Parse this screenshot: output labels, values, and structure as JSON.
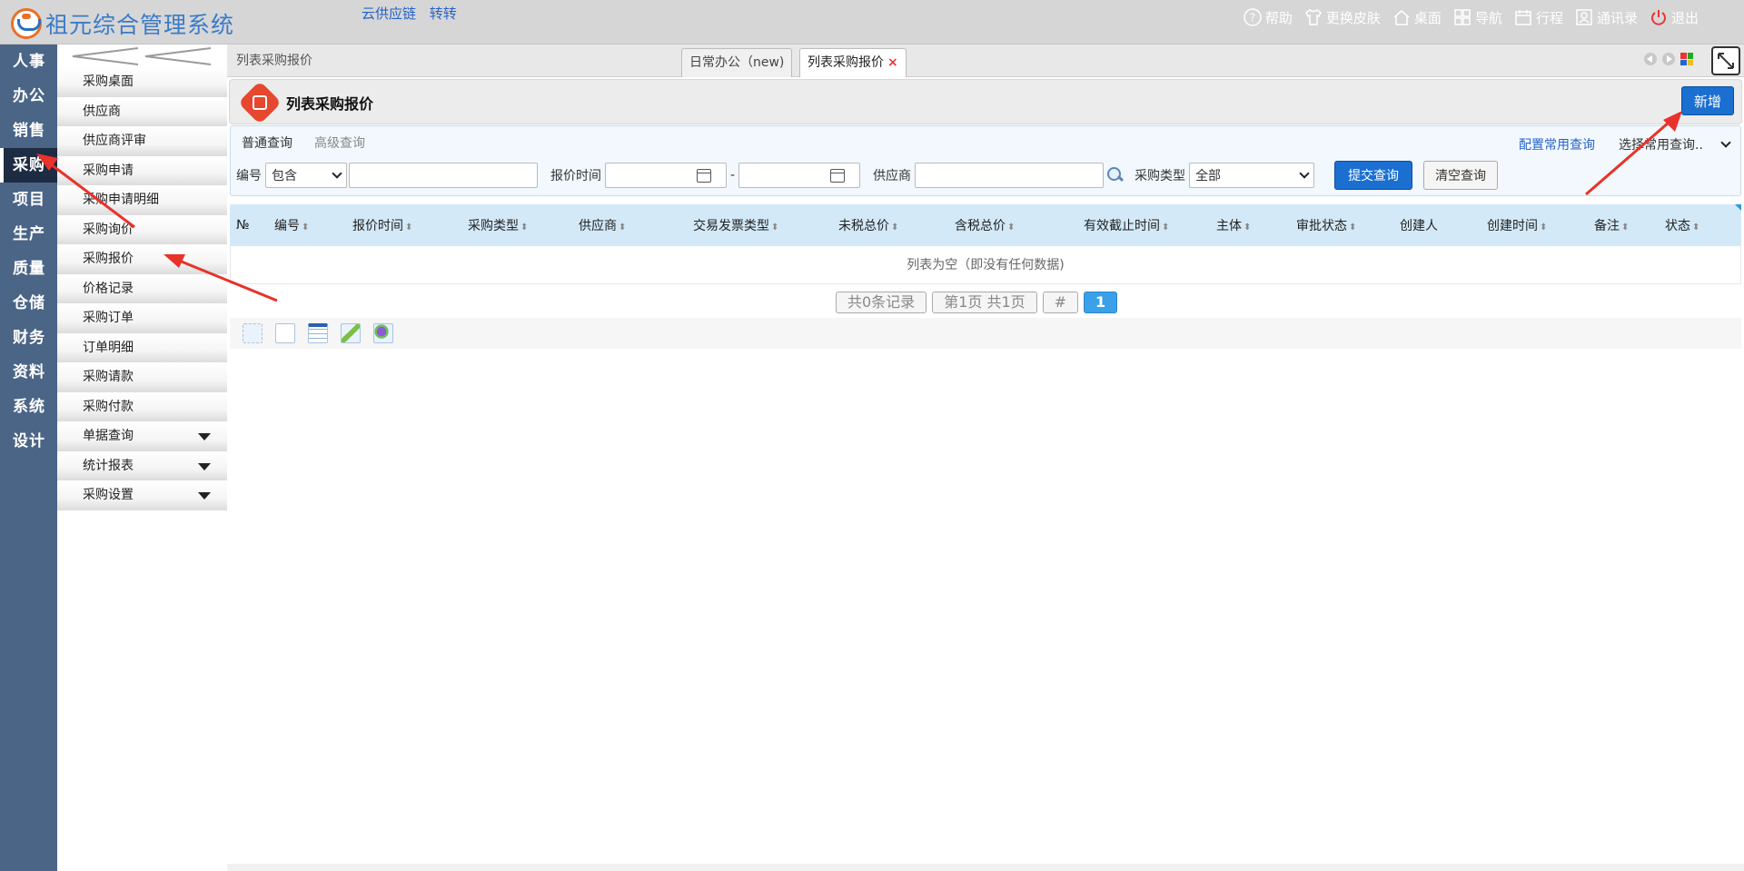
{
  "app": {
    "title": "祖元综合管理系统",
    "links": [
      "云供应链",
      "转转"
    ]
  },
  "top_tools": [
    {
      "label": "帮助",
      "icon": "help-icon"
    },
    {
      "label": "更换皮肤",
      "icon": "shirt-icon"
    },
    {
      "label": "桌面",
      "icon": "home-icon"
    },
    {
      "label": "导航",
      "icon": "nav-grid-icon"
    },
    {
      "label": "行程",
      "icon": "calendar-icon"
    },
    {
      "label": "通讯录",
      "icon": "contacts-icon"
    },
    {
      "label": "退出",
      "icon": "power-icon"
    }
  ],
  "modules": [
    "人事",
    "办公",
    "销售",
    "采购",
    "项目",
    "生产",
    "质量",
    "仓储",
    "财务",
    "资料",
    "系统",
    "设计"
  ],
  "active_module": "采购",
  "submenu": [
    {
      "label": "采购桌面"
    },
    {
      "label": "供应商"
    },
    {
      "label": "供应商评审"
    },
    {
      "label": "采购申请"
    },
    {
      "label": "采购申请明细"
    },
    {
      "label": "采购询价"
    },
    {
      "label": "采购报价"
    },
    {
      "label": "价格记录"
    },
    {
      "label": "采购订单"
    },
    {
      "label": "订单明细"
    },
    {
      "label": "采购请款"
    },
    {
      "label": "采购付款"
    },
    {
      "label": "单据查询",
      "expandable": true
    },
    {
      "label": "统计报表",
      "expandable": true
    },
    {
      "label": "采购设置",
      "expandable": true
    }
  ],
  "breadcrumb": "列表采购报价",
  "tabs": [
    {
      "label": "日常办公（new)",
      "active": false
    },
    {
      "label": "列表采购报价",
      "active": true,
      "close": "×"
    }
  ],
  "page": {
    "title": "列表采购报价",
    "add_button": "新增"
  },
  "query": {
    "tab_basic": "普通查询",
    "tab_advanced": "高级查询",
    "config_link": "配置常用查询",
    "common_query_placeholder": "选择常用查询..",
    "code_label": "编号",
    "code_op": "包含",
    "time_label": "报价时间",
    "dash": "-",
    "supplier_label": "供应商",
    "type_label": "采购类型",
    "type_value": "全部",
    "submit": "提交查询",
    "clear": "清空查询"
  },
  "table": {
    "columns": [
      "№",
      "编号",
      "报价时间",
      "采购类型",
      "供应商",
      "交易发票类型",
      "未税总价",
      "含税总价",
      "有效截止时间",
      "主体",
      "审批状态",
      "创建人",
      "创建时间",
      "备注",
      "状态"
    ],
    "sortable": [
      false,
      true,
      true,
      true,
      true,
      true,
      true,
      true,
      true,
      true,
      true,
      false,
      true,
      true,
      true
    ],
    "empty_text": "列表为空（即没有任何数据)"
  },
  "pager": {
    "total": "共0条记录",
    "page_info": "第1页 共1页",
    "hash": "#",
    "current": "1"
  },
  "colors": {
    "rail": "#4b6587",
    "rail_active": "#1d2b43",
    "accent": "#1a6fd1",
    "header_row": "#d3e9f8",
    "annotation": "#e8322a"
  }
}
